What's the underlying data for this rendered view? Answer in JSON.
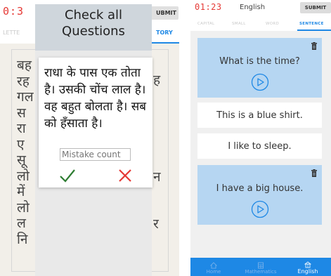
{
  "left_screen": {
    "timer": "0:3",
    "submit_label": "UBMIT",
    "tabs": [
      {
        "label": "LETTE"
      },
      {
        "label": "TORY"
      }
    ],
    "background_text_left": "बह\nरह\nगल\nस\nरा\nए\nसू\nलो\nमें\nलो\nल\nनि",
    "background_text_right": [
      "ह",
      "न",
      "र"
    ],
    "dialog": {
      "title": "Check all Questions",
      "passage": "राधा के पास एक तोता है। उसकी चोंच लाल है। वह बहुत बोलता है। सब को हँसाता है।",
      "mistake_placeholder": "Mistake count",
      "accept_icon": "check-icon",
      "reject_icon": "close-icon",
      "accept_color": "#2e7d32",
      "reject_color": "#e53935"
    }
  },
  "right_screen": {
    "timer": "01:23",
    "title": "English",
    "submit_label": "SUBMIT",
    "tabs": [
      {
        "label": "CAPITAL",
        "active": false
      },
      {
        "label": "SMALL",
        "active": false
      },
      {
        "label": "WORD",
        "active": false
      },
      {
        "label": "SENTENCE",
        "active": true
      }
    ],
    "sentences": [
      {
        "text": "What is the time?",
        "selected": true
      },
      {
        "text": "This is a blue shirt.",
        "selected": false
      },
      {
        "text": "I like to sleep.",
        "selected": false
      },
      {
        "text": "I have a big house.",
        "selected": true
      }
    ],
    "bottom_nav": [
      {
        "label": "Home",
        "icon": "home-icon",
        "active": false
      },
      {
        "label": "Mathematics",
        "icon": "calculator-icon",
        "active": false
      },
      {
        "label": "English",
        "icon": "english-icon",
        "active": true
      }
    ]
  },
  "colors": {
    "accent": "#1e88e5",
    "timer": "#e53935",
    "selected_card": "#b6d6f2"
  }
}
